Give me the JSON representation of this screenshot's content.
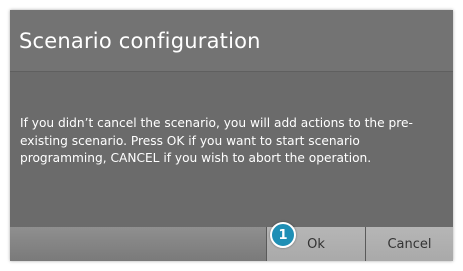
{
  "dialog": {
    "title": "Scenario configuration",
    "message": "If you didn’t cancel the scenario, you will add actions to the pre-existing scenario. Press OK if you want to start scenario programming, CANCEL if you wish to abort the operation.",
    "ok_label": "Ok",
    "cancel_label": "Cancel"
  },
  "callout": {
    "number": "1"
  },
  "colors": {
    "dialog_background": "#6e6e6e",
    "button_background": "#b0b0b0",
    "callout_badge": "#1f8fb5"
  }
}
